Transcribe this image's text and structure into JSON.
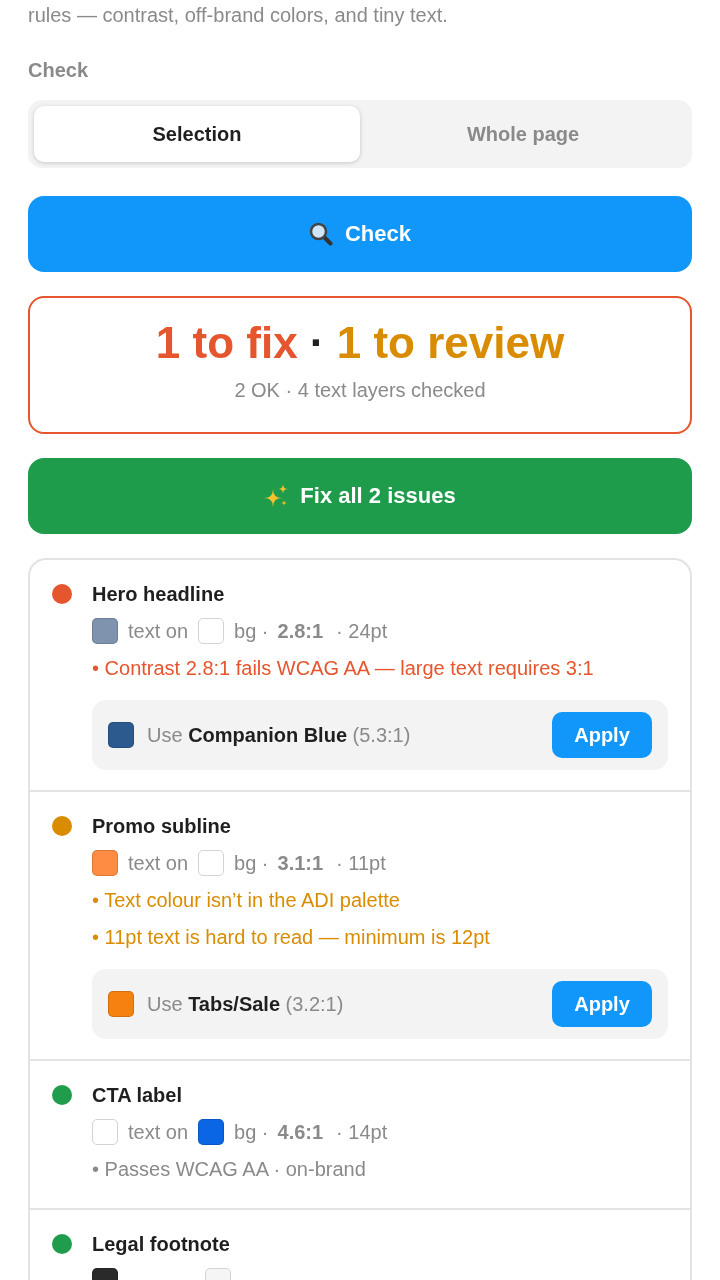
{
  "intro": {
    "text": "rules — contrast, off-brand colors, and tiny text."
  },
  "scope": {
    "label": "Check",
    "tabs": [
      {
        "label": "Selection",
        "selected": true
      },
      {
        "label": "Whole page",
        "selected": false
      }
    ]
  },
  "check_button": {
    "label": "Check"
  },
  "summary": {
    "kind": "fix",
    "headline": [
      {
        "text": "1 to fix",
        "color": "#e5552e"
      },
      {
        "text": "·",
        "color": "#222222"
      },
      {
        "text": "1 to review",
        "color": "#d98c00"
      }
    ],
    "detail": "2 OK · 4 text layers checked"
  },
  "fix_all_button": {
    "label": "Fix all 2 issues"
  },
  "results": [
    {
      "name": "Hero headline",
      "kind": "fix",
      "meta": {
        "text_swatch": {
          "color": "#7f93ae"
        },
        "text_label": "text on",
        "bg_swatch": {
          "color": "#ffffff"
        },
        "bg_label": "bg ·",
        "ratio": "2.8:1",
        "size": "· 24pt"
      },
      "notes": [
        "• Contrast 2.8:1 fails WCAG AA — large text requires 3:1"
      ],
      "suggestion": {
        "swatch": {
          "color": "#2c5a8e"
        },
        "text": "Use **Companion Blue** (5.3:1)",
        "button": "Apply"
      }
    },
    {
      "name": "Promo subline",
      "kind": "review",
      "meta": {
        "text_swatch": {
          "color": "#ff8c42"
        },
        "text_label": "text on",
        "bg_swatch": {
          "color": "#ffffff"
        },
        "bg_label": "bg ·",
        "ratio": "3.1:1",
        "size": "· 11pt"
      },
      "notes": [
        "• Text colour isn’t in the ADI palette",
        "• 11pt text is hard to read — minimum is 12pt"
      ],
      "suggestion": {
        "swatch": {
          "color": "#f5820f"
        },
        "text": "Use **Tabs/Sale** (3.2:1)",
        "button": "Apply"
      }
    },
    {
      "name": "CTA label",
      "kind": "ok",
      "meta": {
        "text_swatch": {
          "color": "#ffffff"
        },
        "text_label": "text on",
        "bg_swatch": {
          "color": "#0a66e4"
        },
        "bg_label": "bg ·",
        "ratio": "4.6:1",
        "size": "· 14pt"
      },
      "notes": [
        "• Passes WCAG AA · on-brand"
      ]
    },
    {
      "name": "Legal footnote",
      "kind": "ok",
      "meta": {
        "text_swatch": {
          "color": "#2a2a2a"
        },
        "bg_swatch": {
          "color": "#f5f5f5"
        }
      }
    }
  ]
}
